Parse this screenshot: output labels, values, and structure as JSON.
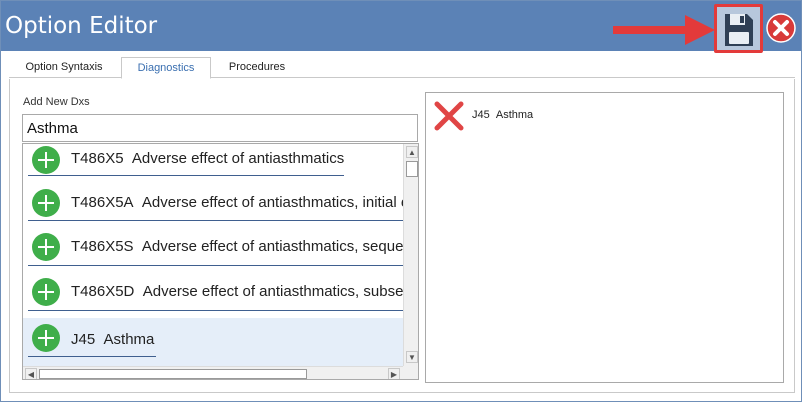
{
  "window": {
    "title": "Option Editor"
  },
  "colors": {
    "titlebar": "#5b82b6",
    "accent": "#3a6fb0",
    "add_icon": "#3fae4a",
    "remove_icon": "#e04545",
    "annotation": "#e33a3a",
    "selection": "#e5eef9"
  },
  "toolbar": {
    "save_icon": "floppy-disk-icon",
    "close_icon": "close-circle-icon",
    "annotation_icon": "arrow-right-icon"
  },
  "tabs": [
    {
      "label": "Option Syntaxis",
      "active": false
    },
    {
      "label": "Diagnostics",
      "active": true
    },
    {
      "label": "Procedures",
      "active": false
    }
  ],
  "add_dx": {
    "label": "Add New Dxs",
    "search_value": "Asthma"
  },
  "results": [
    {
      "code": "T486X5",
      "desc": "Adverse effect of antiasthmatics",
      "icon": "add-icon"
    },
    {
      "code": "T486X5A",
      "desc": "Adverse effect of antiasthmatics, initial e",
      "icon": "add-icon"
    },
    {
      "code": "T486X5S",
      "desc": "Adverse effect of antiasthmatics, sequela",
      "icon": "add-icon"
    },
    {
      "code": "T486X5D",
      "desc": "Adverse effect of antiasthmatics, subseq",
      "icon": "add-icon"
    },
    {
      "code": "J45",
      "desc": "Asthma",
      "icon": "add-icon",
      "selected": true
    }
  ],
  "selected_dxs": [
    {
      "code": "J45",
      "desc": "Asthma",
      "icon": "remove-icon"
    }
  ]
}
